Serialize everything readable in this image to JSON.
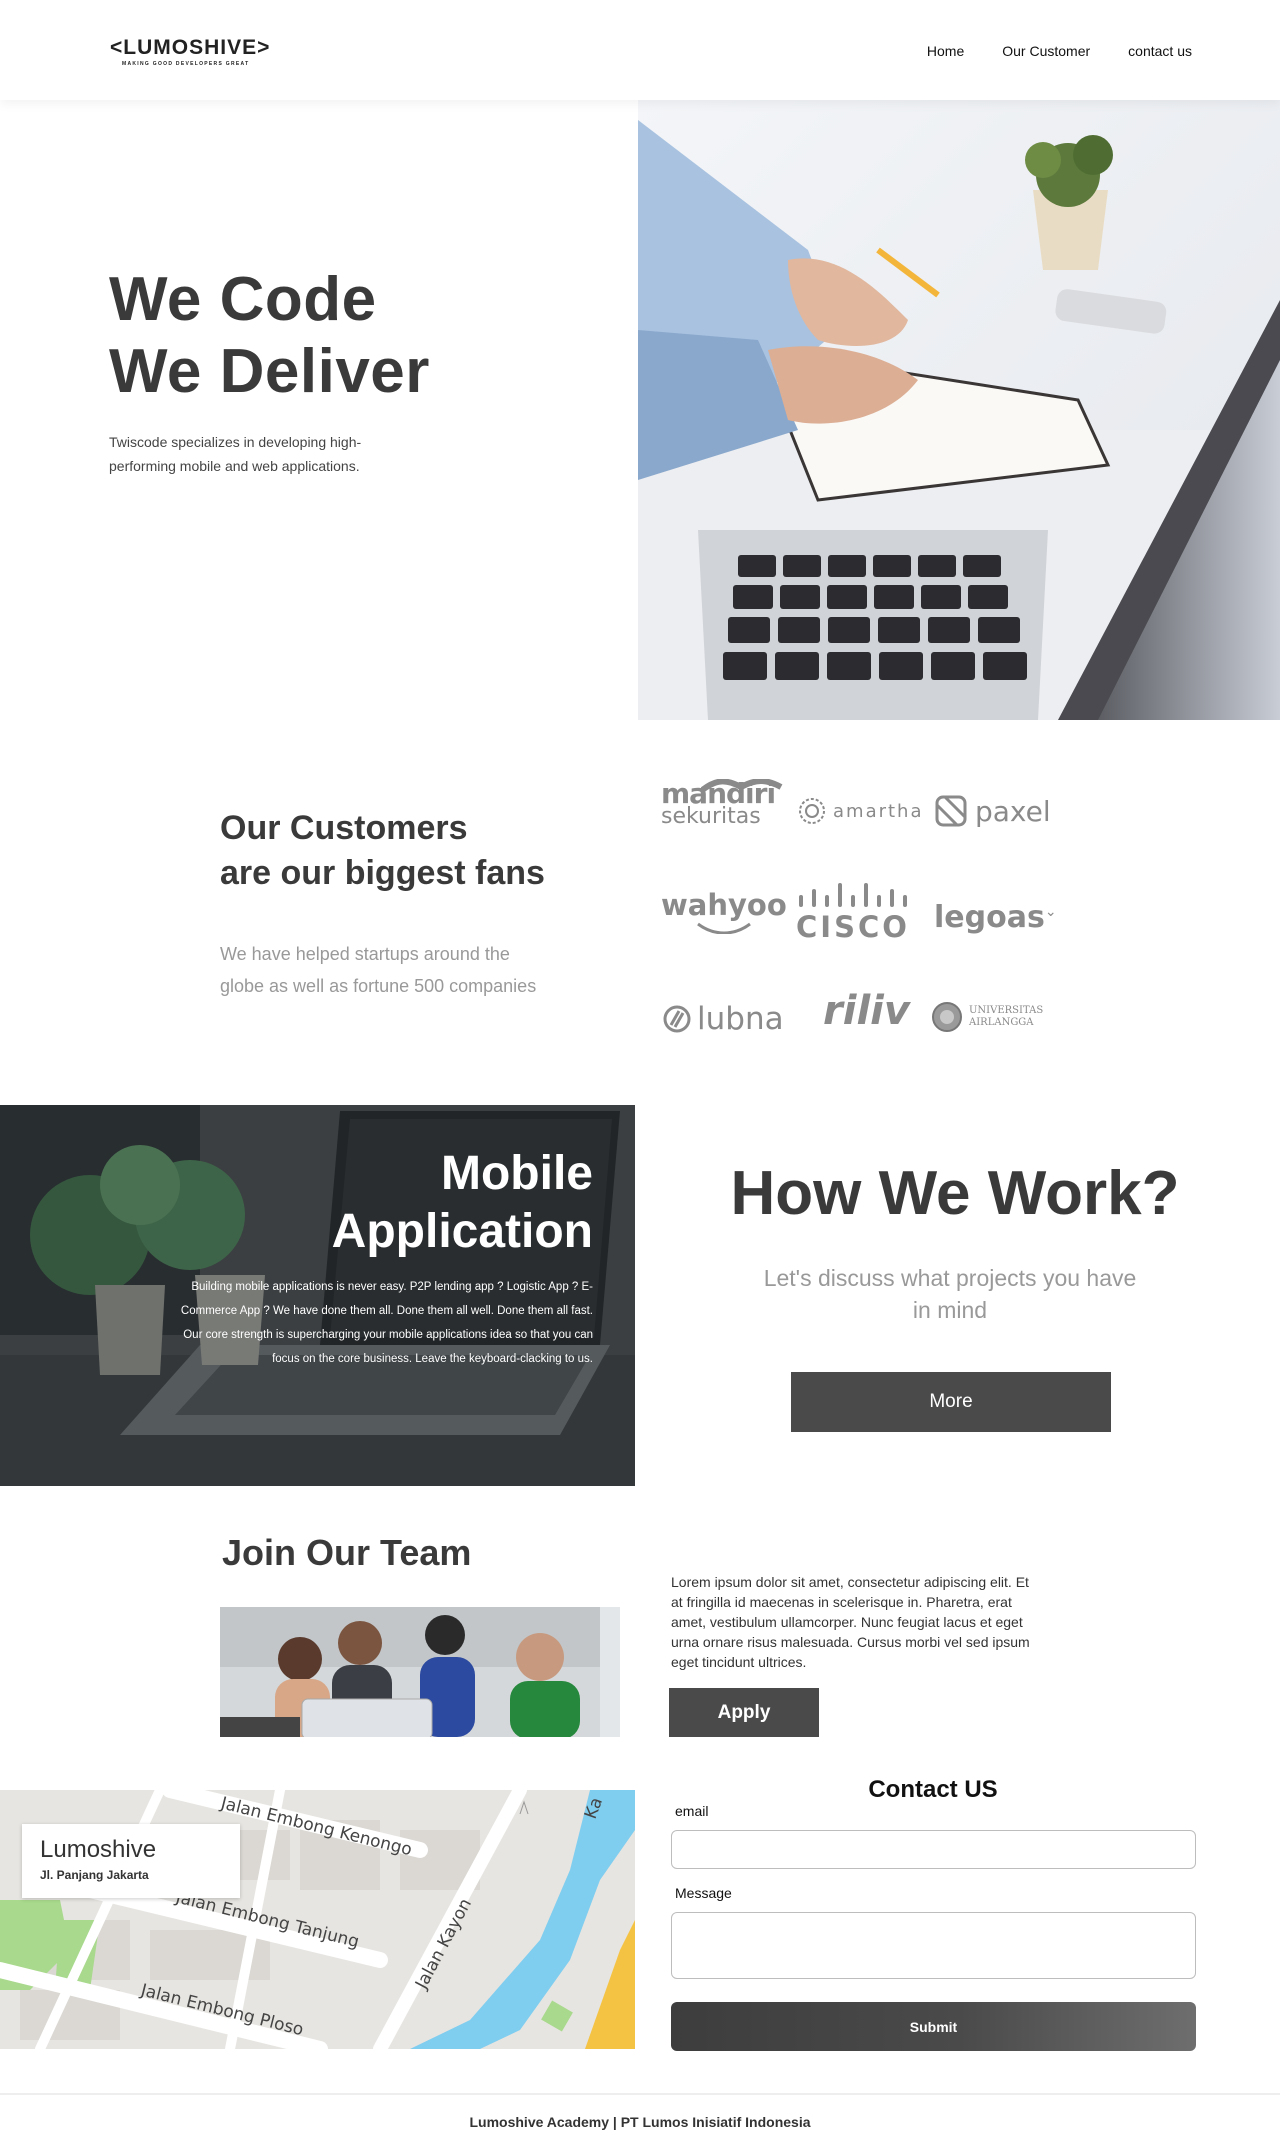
{
  "brand": {
    "name": "<LUMOSHIVE>",
    "tagline": "MAKING GOOD DEVELOPERS GREAT"
  },
  "nav": {
    "items": [
      {
        "label": "Home"
      },
      {
        "label": "Our Customer"
      },
      {
        "label": "contact us"
      }
    ]
  },
  "hero": {
    "title_line1": "We Code",
    "title_line2": "We Deliver",
    "description": "Twiscode specializes in developing high-performing mobile and web applications."
  },
  "customers": {
    "title_line1": "Our Customers",
    "title_line2": "are our biggest fans",
    "description": "We have helped startups around the globe as well as fortune 500 companies",
    "logos": [
      {
        "name": "mandiri sekuritas",
        "line1": "mandiri",
        "line2": "sekuritas"
      },
      {
        "name": "amartha",
        "text": "amartha"
      },
      {
        "name": "paxel",
        "text": "paxel"
      },
      {
        "name": "wahyoo",
        "text": "wahyoo"
      },
      {
        "name": "cisco",
        "text": "CISCO"
      },
      {
        "name": "legoas",
        "text": "legoas"
      },
      {
        "name": "lubna",
        "text": "lubna"
      },
      {
        "name": "riliv",
        "text": "riliv"
      },
      {
        "name": "universitas airlangga",
        "line1": "UNIVERSITAS",
        "line2": "AIRLANGGA"
      }
    ]
  },
  "mobile_app": {
    "title_line1": "Mobile",
    "title_line2": "Application",
    "description": "Building mobile applications is never easy. P2P lending app ? Logistic App ? E-Commerce App ? We have done them all. Done them all well. Done them all fast. Our core strength is supercharging your mobile applications idea so that you can focus on the core business. Leave the keyboard-clacking to us."
  },
  "how_we_work": {
    "title": "How We Work?",
    "subtitle": "Let's discuss what projects you have in mind",
    "button": "More"
  },
  "join": {
    "title": "Join Our Team",
    "description": "Lorem ipsum dolor sit amet, consectetur adipiscing elit. Et at fringilla id maecenas in scelerisque in. Pharetra, erat amet, vestibulum ullamcorper. Nunc feugiat lacus et eget urna ornare risus malesuada. Cursus morbi vel sed ipsum eget tincidunt ultrices.",
    "button": "Apply"
  },
  "map": {
    "card_title": "Lumoshive",
    "card_address": "Jl. Panjang Jakarta",
    "streets": [
      "Jalan Embong Kenongo",
      "Jalan Embong Tanjung",
      "Jalan Embong Ploso",
      "Jalan Kayon",
      "Ka"
    ]
  },
  "contact": {
    "title": "Contact US",
    "email_label": "email",
    "email_value": "",
    "message_label": "Message",
    "message_value": "",
    "submit": "Submit"
  },
  "footer": {
    "text": "Lumoshive Academy | PT Lumos Inisiatif Indonesia"
  },
  "colors": {
    "primary_button": "#4a4a4a",
    "heading": "#3a3a3a",
    "muted": "#999999"
  }
}
